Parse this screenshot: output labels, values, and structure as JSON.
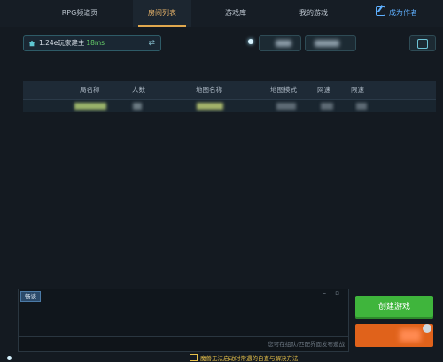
{
  "nav": {
    "tabs": [
      {
        "label": "RPG频道页"
      },
      {
        "label": "房间列表"
      },
      {
        "label": "游戏库"
      },
      {
        "label": "我的游戏"
      }
    ],
    "author_label": "成为作者"
  },
  "server": {
    "name": "1.24e玩家建主",
    "ping": "18ms"
  },
  "table": {
    "columns": [
      "局名称",
      "人数",
      "地图名称",
      "地图模式",
      "网速",
      "限速"
    ]
  },
  "chat": {
    "tab_label": "畅谈",
    "controls": "– ▫",
    "input_placeholder": "您可在组队/匹配界面发布邀战"
  },
  "actions": {
    "create_game_label": "创建游戏"
  },
  "notice": {
    "text": "魔兽无法启动时常遇的自查与解决方法"
  },
  "colors": {
    "accent_tab": "#e0a84e",
    "create_button": "#3fb53c",
    "orange_button": "#e0621b",
    "link": "#5fb0ff"
  }
}
